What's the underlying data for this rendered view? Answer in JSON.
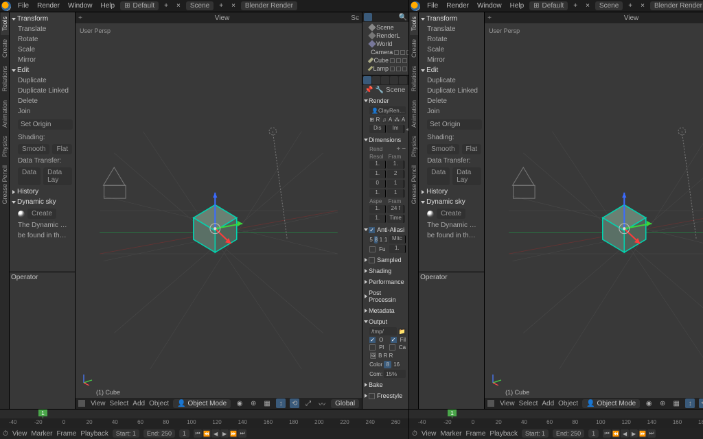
{
  "menu": {
    "file": "File",
    "render": "Render",
    "window": "Window",
    "help": "Help",
    "layout": "Default",
    "layout_close": "×",
    "scene_label": "Scene",
    "plus": "+",
    "x": "×",
    "engine": "Blender Render"
  },
  "vtabs": [
    "Tools",
    "Create",
    "Relations",
    "Animation",
    "Physics",
    "Grease Pencil"
  ],
  "tool_panel": {
    "transform_hdr": "Transform",
    "transform_items": [
      "Translate",
      "Rotate",
      "Scale",
      "Mirror"
    ],
    "edit_hdr": "Edit",
    "edit_items": [
      "Duplicate",
      "Duplicate Linked",
      "Delete",
      "Join"
    ],
    "set_origin": "Set Origin",
    "shading_hdr": "Shading:",
    "shading_smooth": "Smooth",
    "shading_flat": "Flat",
    "data_transfer": "Data Transfer:",
    "data": "Data",
    "data_lay": "Data Lay",
    "history": "History",
    "dynsky": "Dynamic sky",
    "create": "Create",
    "dyn_line1": "The Dynamic …",
    "dyn_line2": "be found in th…"
  },
  "viewport": {
    "view": "View",
    "header_right": "Sє",
    "persp": "User Persp",
    "object_label": "(1) Cube",
    "footer": {
      "view": "View",
      "select": "Select",
      "add": "Add",
      "object": "Object",
      "mode": "Object Mode",
      "global": "Global"
    }
  },
  "operator_title": "Operator",
  "outliner": {
    "items": [
      "Scene",
      "RenderL",
      "World",
      "Camera",
      "Cube",
      "Lamp"
    ]
  },
  "props": {
    "breadcrumb": "Scene",
    "render_hdr": "Render",
    "render_btn": "ClayRen…",
    "icons": [
      "⊞",
      "R",
      "♫",
      "A",
      "⁂",
      "A"
    ],
    "display": [
      "Dis",
      "Im"
    ],
    "dimensions_hdr": "Dimensions",
    "render_preset_lbl": "Rend",
    "cols": [
      "Resol",
      "Fram"
    ],
    "dim_rows": [
      [
        "1.",
        "1."
      ],
      [
        "1.",
        "2"
      ],
      [
        "0",
        "1"
      ],
      [
        "1.",
        "1"
      ]
    ],
    "cols2": [
      "Aspe",
      "Fram"
    ],
    "dim_rows2": [
      [
        "1.",
        "24 f"
      ],
      [
        "1.",
        "Time"
      ]
    ],
    "aa_hdr": "Anti-Aliasi",
    "aa_row1": [
      "5",
      "8",
      "1",
      "1"
    ],
    "aa_row1_r": "Mitc",
    "aa_row2_l": "Fu",
    "aa_row2_r": "1.",
    "sampled": "Sampled",
    "shading": "Shading",
    "performance": "Performance",
    "postproc": "Post Processin",
    "metadata": "Metadata",
    "output_hdr": "Output",
    "output_path": "/tmp/",
    "out_icons1_l": "O",
    "out_icons1_r": "Fil",
    "out_icons2_l": "Pl",
    "out_icons2_r": "Ca",
    "out_icons3_l": "B R R",
    "out_icons3_r": "",
    "color_lbl": "Color",
    "color_v1": "8",
    "color_v2": "16",
    "comp_lbl": "Com:",
    "comp_v": "15%",
    "bake": "Bake",
    "freestyle": "Freestyle"
  },
  "timeline": {
    "ticks": [
      "-40",
      "-20",
      "0",
      "20",
      "40",
      "60",
      "80",
      "100",
      "120",
      "140",
      "160",
      "180",
      "200",
      "220",
      "240",
      "260"
    ],
    "current": "1",
    "bar": {
      "view": "View",
      "marker": "Marker",
      "frame": "Frame",
      "playback": "Playback",
      "start": "Start:",
      "start_v": "1",
      "end": "End:",
      "end_v": "250",
      "cur_v": "1"
    }
  }
}
